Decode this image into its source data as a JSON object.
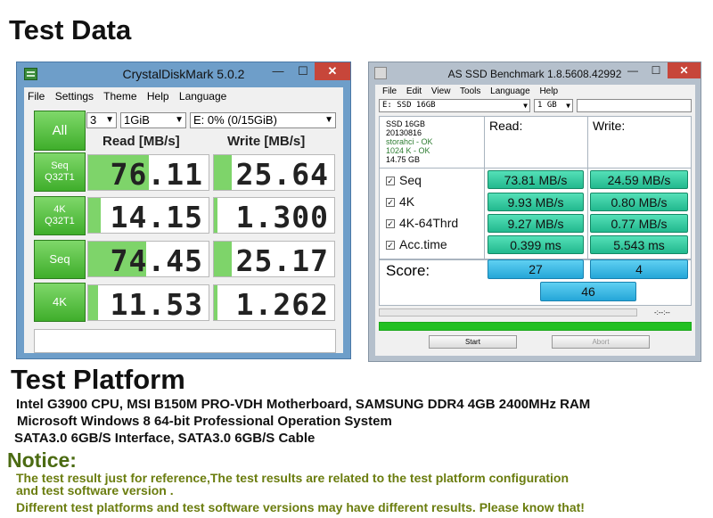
{
  "heading": "Test Data",
  "cdm": {
    "title": "CrystalDiskMark 5.0.2",
    "window_buttons": {
      "minimize": "—",
      "maximize": "☐",
      "close": "✕"
    },
    "menu": [
      "File",
      "Settings",
      "Theme",
      "Help",
      "Language"
    ],
    "all_label": "All",
    "runs": "3",
    "size": "1GiB",
    "drive": "E: 0% (0/15GiB)",
    "read_header": "Read [MB/s]",
    "write_header": "Write [MB/s]",
    "rows": [
      {
        "label": "Seq",
        "sub": "Q32T1",
        "read": "76.11",
        "write": "25.64",
        "read_fill": 0.5,
        "write_fill": 0.15
      },
      {
        "label": "4K",
        "sub": "Q32T1",
        "read": "14.15",
        "write": "1.300",
        "read_fill": 0.1,
        "write_fill": 0.03
      },
      {
        "label": "Seq",
        "sub": "",
        "read": "74.45",
        "write": "25.17",
        "read_fill": 0.48,
        "write_fill": 0.15
      },
      {
        "label": "4K",
        "sub": "",
        "read": "11.53",
        "write": "1.262",
        "read_fill": 0.08,
        "write_fill": 0.03
      }
    ]
  },
  "asd": {
    "title": "AS SSD Benchmark 1.8.5608.42992",
    "window_buttons": {
      "minimize": "—",
      "maximize": "☐",
      "close": "✕"
    },
    "menu": [
      "File",
      "Edit",
      "View",
      "Tools",
      "Language",
      "Help"
    ],
    "drive": "E: SSD 16GB",
    "size": "1 GB",
    "info": [
      "SSD 16GB",
      "20130816",
      "storahci - OK",
      "1024 K - OK",
      "14.75 GB"
    ],
    "read_header": "Read:",
    "write_header": "Write:",
    "rows": [
      {
        "label": "Seq",
        "read": "73.81 MB/s",
        "write": "24.59 MB/s"
      },
      {
        "label": "4K",
        "read": "9.93 MB/s",
        "write": "0.80 MB/s"
      },
      {
        "label": "4K-64Thrd",
        "read": "9.27 MB/s",
        "write": "0.77 MB/s"
      },
      {
        "label": "Acc.time",
        "read": "0.399 ms",
        "write": "5.543 ms"
      }
    ],
    "score_label": "Score:",
    "score_read": "27",
    "score_write": "4",
    "score_total": "46",
    "time": "-:--:--",
    "start": "Start",
    "abort": "Abort",
    "progress": 1.0
  },
  "platform": {
    "title": "Test Platform",
    "lines": [
      "Intel G3900 CPU, MSI B150M PRO-VDH Motherboard, SAMSUNG DDR4 4GB 2400MHz RAM",
      "Microsoft Windows 8 64-bit Professional Operation System",
      "SATA3.0 6GB/S Interface,  SATA3.0 6GB/S Cable"
    ]
  },
  "notice": {
    "title": "Notice:",
    "lines": [
      "The test result just for reference,The test results are related to the test platform configuration",
      "and test software version .",
      "Different test platforms and test software versions may have different results. Please know that!"
    ]
  }
}
